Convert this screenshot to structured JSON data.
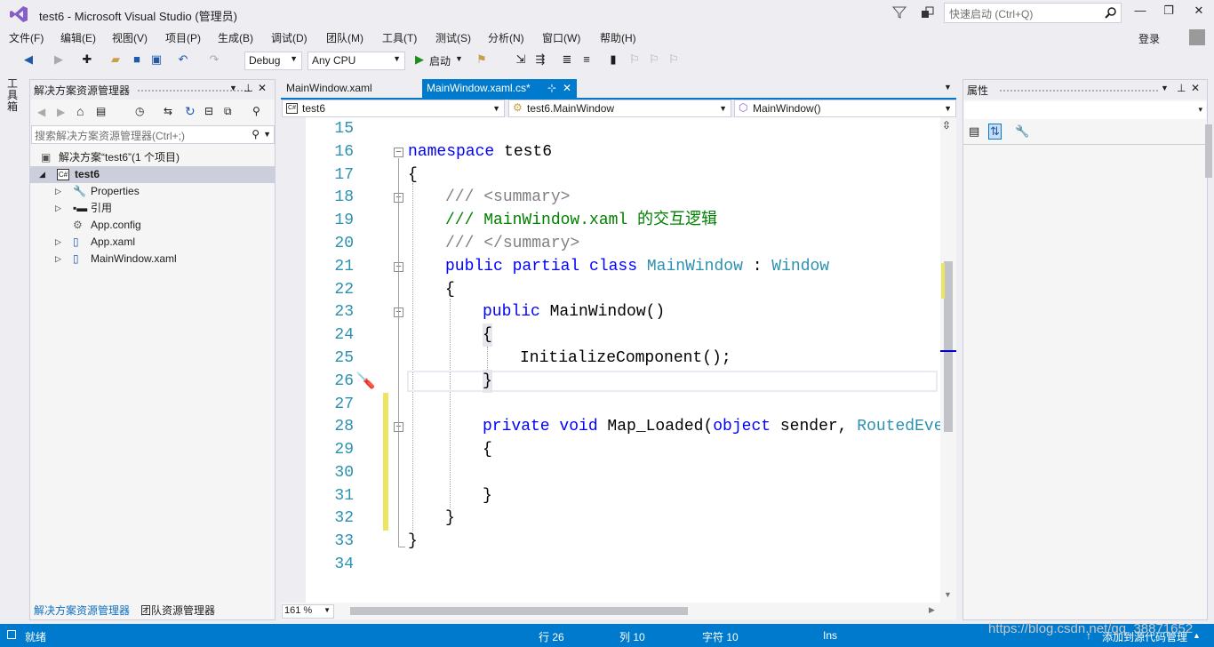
{
  "title_bar": {
    "title": "test6 - Microsoft Visual Studio (管理员)",
    "quick_launch_placeholder": "快速启动 (Ctrl+Q)",
    "minimize": "—",
    "maximize": "❐",
    "close": "✕"
  },
  "menu": [
    "文件(F)",
    "编辑(E)",
    "视图(V)",
    "项目(P)",
    "生成(B)",
    "调试(D)",
    "团队(M)",
    "工具(T)",
    "测试(S)",
    "分析(N)",
    "窗口(W)",
    "帮助(H)"
  ],
  "account": {
    "login": "登录"
  },
  "toolbar": {
    "config": "Debug",
    "platform": "Any CPU",
    "start": "启动"
  },
  "toolbox": {
    "label": "工具箱"
  },
  "solution_explorer": {
    "title": "解决方案资源管理器",
    "search_placeholder": "搜索解决方案资源管理器(Ctrl+;)",
    "solution": "解决方案“test6”(1 个项目)",
    "project": "test6",
    "items": [
      "Properties",
      "引用",
      "App.config",
      "App.xaml",
      "MainWindow.xaml"
    ]
  },
  "editor": {
    "tabs": [
      {
        "label": "MainWindow.xaml"
      },
      {
        "label": "MainWindow.xaml.cs*",
        "pin": "⊹",
        "close": "✕"
      }
    ],
    "nav": {
      "project": "test6",
      "class": "test6.MainWindow",
      "member": "MainWindow()"
    },
    "line_numbers": [
      "15",
      "16",
      "17",
      "18",
      "19",
      "20",
      "21",
      "22",
      "23",
      "24",
      "25",
      "26",
      "27",
      "28",
      "29",
      "30",
      "31",
      "32",
      "33",
      "34"
    ],
    "zoom": "161 %",
    "code": {
      "l16_kw": "namespace",
      "l16_name": " test6",
      "l17": "{",
      "l18_comment": "/// ",
      "l18_tag": "<summary>",
      "l19_comment": "/// MainWindow.xaml 的交互逻辑",
      "l20_comment": "/// ",
      "l20_tag": "</summary>",
      "l21_kw": "public partial class",
      "l21_type": "MainWindow",
      "l21_colon": " : ",
      "l21_base": "Window",
      "l22": "{",
      "l23_kw": "public",
      "l23_rest": " MainWindow()",
      "l24": "{",
      "l25": "InitializeComponent();",
      "l26": "}",
      "l28_kw": "private void",
      "l28_name": " Map_Loaded(",
      "l28_kw2": "object",
      "l28_param": " sender, ",
      "l28_type": "RoutedEven",
      "l29": "{",
      "l31": "}",
      "l32": "}",
      "l33": "}"
    }
  },
  "properties": {
    "title": "属性"
  },
  "bottom_tabs": [
    "解决方案资源管理器",
    "团队资源管理器"
  ],
  "status": {
    "ready": "就绪",
    "line": "行 26",
    "col": "列 10",
    "char": "字符 10",
    "mode": "Ins",
    "source_control": "添加到源代码管理"
  },
  "watermark": "https://blog.csdn.net/qq_38871652",
  "colors": {
    "accent": "#007acc",
    "keyword": "#0000ff",
    "type": "#2b91af",
    "comment": "#008000"
  }
}
